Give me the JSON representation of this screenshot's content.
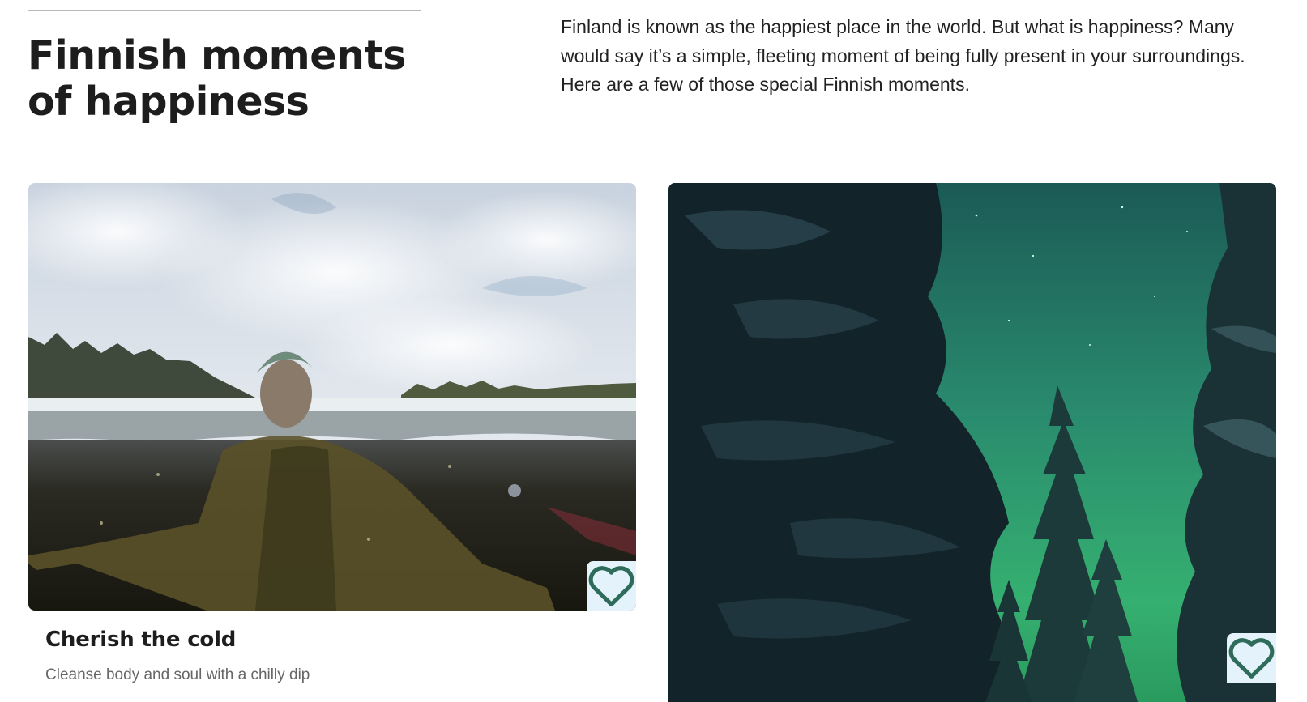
{
  "section": {
    "headline_line1": "Finnish moments",
    "headline_line2": "of happiness",
    "intro": "Finland is known as the happiest place in the world. But what is happiness? Many would say it’s a simple, fleeting moment of being fully present in your surroundings. Here are a few of those special Finnish moments."
  },
  "cards": [
    {
      "title": "Cherish the cold",
      "subtitle": "Cleanse body and soul with a chilly dip",
      "image": "woman-ice-swimming-in-frozen-lake",
      "favorite_icon": "heart-outline-icon"
    },
    {
      "title": "",
      "subtitle": "",
      "image": "snowy-forest-northern-lights",
      "favorite_icon": "heart-outline-icon"
    }
  ],
  "colors": {
    "favorite_button_bg": "#e4f3fb",
    "favorite_icon": "#2e6b5a",
    "aurora": "#2fa873"
  }
}
